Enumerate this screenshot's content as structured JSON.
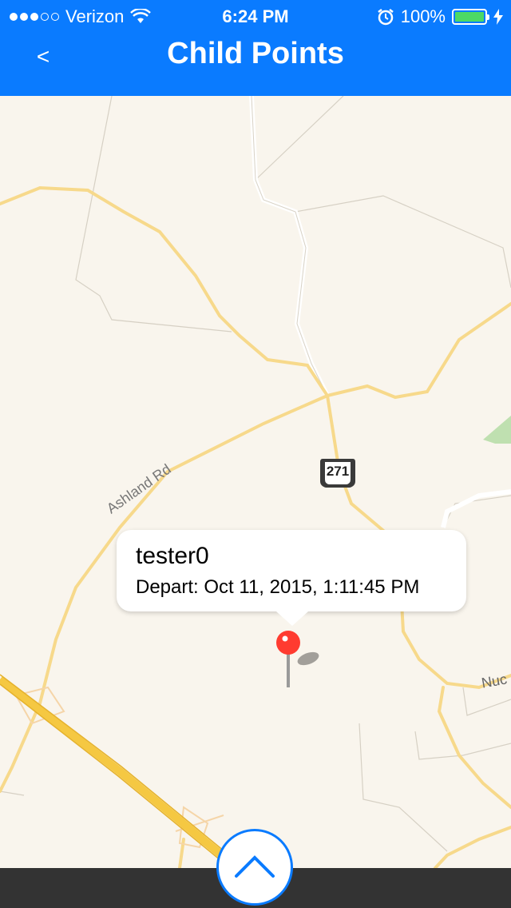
{
  "status_bar": {
    "carrier": "Verizon",
    "time": "6:24 PM",
    "battery": "100%",
    "battery_level": 1.0,
    "signal_bars": 3,
    "signal_total": 5
  },
  "nav": {
    "back_label": "<",
    "title": "Child Points"
  },
  "map": {
    "road_label": "Ashland Rd",
    "road_label_2": "Nuc",
    "route_shield": "271",
    "callout": {
      "name": "tester0",
      "detail": "Depart: Oct 11, 2015, 1:11:45 PM"
    },
    "pin_color": "#ff3b30"
  },
  "colors": {
    "accent": "#0a7bff",
    "map_bg": "#f9f5ed",
    "road": "#f7d98b",
    "highway": "#f5c842",
    "bottom_bar": "#333333"
  },
  "icons": {
    "expand_button": "chevron-up-icon",
    "wifi": "wifi-icon",
    "alarm": "alarm-icon",
    "charging": "bolt-icon"
  }
}
